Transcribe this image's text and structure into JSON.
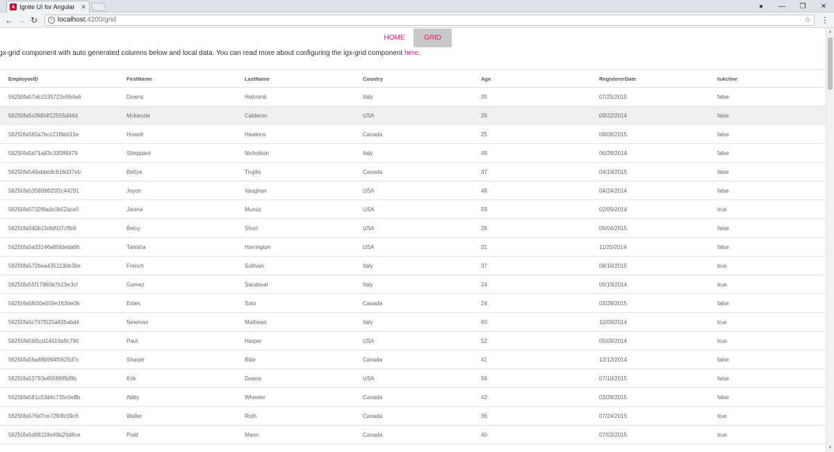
{
  "browser": {
    "tab_title": "Ignite UI for Angular",
    "tab_close": "✕",
    "favicon_letter": "A",
    "url_host": "localhost",
    "url_path": ":4200/grid",
    "controls": {
      "minimize": "—",
      "restore": "❐",
      "close": "✕",
      "profile": "●"
    }
  },
  "nav": {
    "home": "HOME",
    "grid": "GRID",
    "active": "GRID",
    "accent": "#e41c77"
  },
  "intro": {
    "text": "igx-grid component with auto generated columns below and local data. You can read more about configuring the igx-grid component ",
    "link": "here",
    "end": "."
  },
  "grid": {
    "columns": [
      "EmployeeID",
      "FirstName",
      "LastName",
      "Country",
      "Age",
      "RegistererDate",
      "IsActive"
    ],
    "rows": [
      [
        "56250fa57ab1535722e564a6",
        "Downs",
        "Holcomb",
        "Italy",
        "35",
        "07/25/2015",
        "false"
      ],
      [
        "56250fa5c0fd04f12555d44d",
        "Mckenzie",
        "Calderon",
        "USA",
        "26",
        "09/22/2014",
        "false"
      ],
      [
        "56250fa565a7bcc21f6bd15e",
        "Howell",
        "Hawkins",
        "Canada",
        "25",
        "08/08/2015",
        "false"
      ],
      [
        "56250fa5d71a83c33f3f6479",
        "Sheppard",
        "Nicholson",
        "Italy",
        "49",
        "06/28/2014",
        "false"
      ],
      [
        "56250fa546abbe8c616d37eb",
        "Bettye",
        "Trujillo",
        "Canada",
        "37",
        "04/19/2015",
        "false"
      ],
      [
        "56250fa535809820f2c44291",
        "Joyce",
        "Vaughan",
        "USA",
        "48",
        "04/24/2014",
        "false"
      ],
      [
        "56250fa5732f6adc0b52ace0",
        "Janine",
        "Munoz",
        "USA",
        "59",
        "02/09/2014",
        "true"
      ],
      [
        "56250fa540b15dfd507cffb9",
        "Betsy",
        "Short",
        "USA",
        "26",
        "06/04/2015",
        "false"
      ],
      [
        "56250fa5a33146a85fdeda66",
        "Tanisha",
        "Harrington",
        "USA",
        "31",
        "11/25/2014",
        "false"
      ],
      [
        "56250fa572bea435113bb3be",
        "French",
        "Sullivan",
        "Italy",
        "37",
        "08/16/2015",
        "true"
      ],
      [
        "56250fa55f17965b7b19e3cf",
        "Gomez",
        "Sandoval",
        "Italy",
        "24",
        "06/19/2014",
        "true"
      ],
      [
        "56250fa5f630e559e163de06",
        "Estes",
        "Soto",
        "Canada",
        "24",
        "03/28/2015",
        "false"
      ],
      [
        "56250fa5c797f025a835abd4",
        "Newman",
        "Mathews",
        "Italy",
        "60",
        "10/09/2014",
        "true"
      ],
      [
        "56250fa5fd5cd14418a9c790",
        "Paul",
        "Harper",
        "USA",
        "52",
        "05/09/2014",
        "true"
      ],
      [
        "56250fa56a88b994f0925d7c",
        "Sharpe",
        "Blair",
        "Canada",
        "41",
        "12/12/2014",
        "false"
      ],
      [
        "56250fa53793e85f499fbf8b",
        "Kirk",
        "Downs",
        "USA",
        "58",
        "07/10/2015",
        "false"
      ],
      [
        "56250fa581c03d4c735c0e8b",
        "Abby",
        "Wheeler",
        "Canada",
        "42",
        "03/28/2015",
        "false"
      ],
      [
        "56250fa576d7ce7293fc09c6",
        "Walter",
        "Roth",
        "Canada",
        "36",
        "07/24/2015",
        "true"
      ],
      [
        "56250fa5d88119d49b29d8ce",
        "Pratt",
        "Mann",
        "Canada",
        "40",
        "07/03/2015",
        "true"
      ]
    ],
    "hover_row": 1
  }
}
